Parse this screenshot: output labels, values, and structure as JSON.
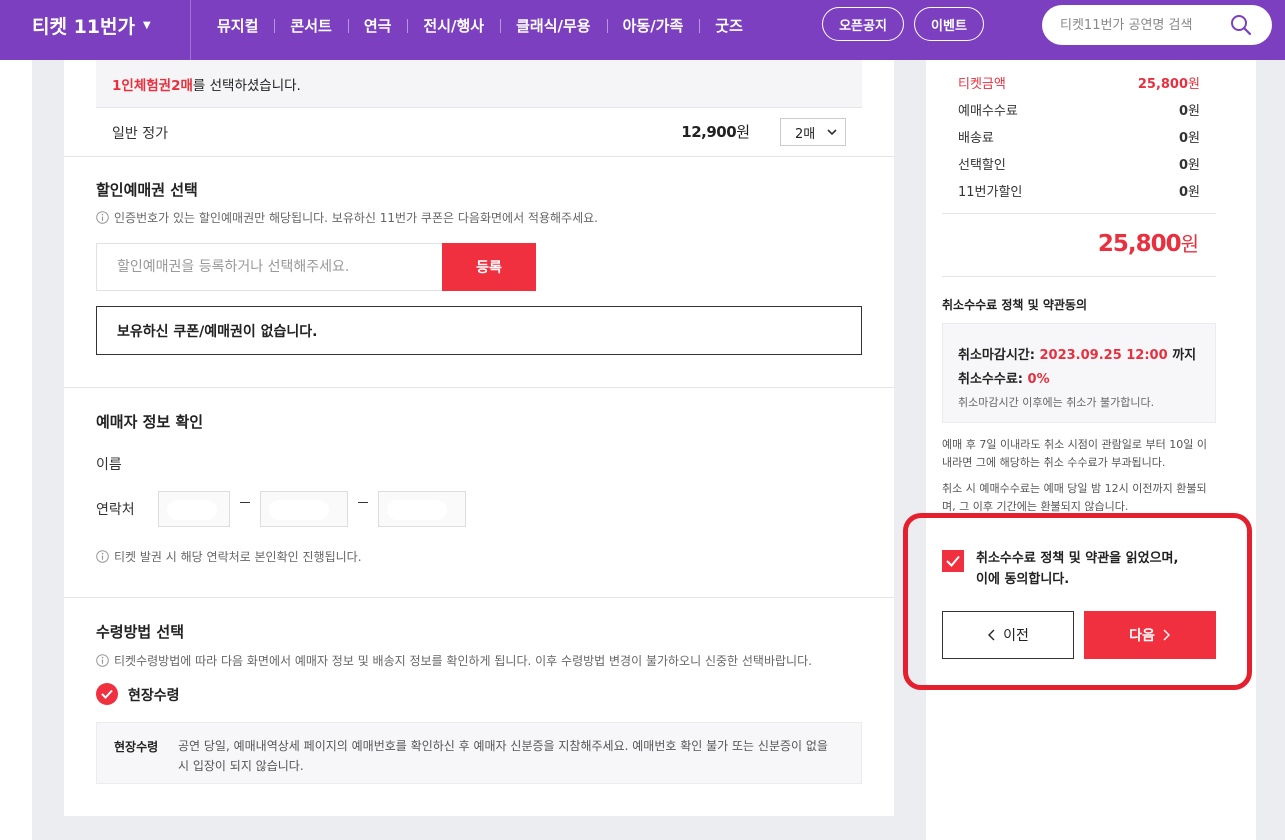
{
  "header": {
    "brand": "티켓 11번가",
    "nav": [
      "뮤지컬",
      "콘서트",
      "연극",
      "전시/행사",
      "클래식/무용",
      "아동/가족",
      "굿즈"
    ],
    "pill_open": "오픈공지",
    "pill_event": "이벤트",
    "search_placeholder": "티켓11번가 공연명 검색"
  },
  "selection": {
    "ticket_name": "1인체험권",
    "count": "2매",
    "suffix": "를 선택하셨습니다.",
    "price_label": "일반 정가",
    "price": "12,900",
    "won": "원",
    "qty": "2매"
  },
  "discount": {
    "title": "할인예매권 선택",
    "note": "인증번호가 있는 할인예매권만 해당됩니다. 보유하신 11번가 쿠폰은 다음화면에서 적용해주세요.",
    "input_placeholder": "할인예매권을 등록하거나 선택해주세요.",
    "register": "등록",
    "empty": "보유하신 쿠폰/예매권이 없습니다."
  },
  "booker": {
    "title": "예매자 정보 확인",
    "name_label": "이름",
    "phone_label": "연락처",
    "note": "티켓 발권 시 해당 연락처로 본인확인 진행됩니다."
  },
  "receive": {
    "title": "수령방법 선택",
    "note": "티켓수령방법에 따라 다음 화면에서 예매자 정보 및 배송지 정보를 확인하게 됩니다. 이후 수령방법 변경이 불가하오니 신중한 선택바랍니다.",
    "option": "현장수령",
    "box_title": "현장수령",
    "box_text": "공연 당일, 예매내역상세 페이지의 예매번호를 확인하신 후 예매자 신분증을 지참해주세요. 예매번호 확인 불가 또는 신분증이 없을 시 입장이 되지 않습니다."
  },
  "fees": [
    {
      "label": "티켓금액",
      "value": "25,800",
      "unit": "원"
    },
    {
      "label": "예매수수료",
      "value": "0",
      "unit": "원"
    },
    {
      "label": "배송료",
      "value": "0",
      "unit": "원"
    },
    {
      "label": "선택할인",
      "value": "0",
      "unit": "원"
    },
    {
      "label": "11번가할인",
      "value": "0",
      "unit": "원"
    }
  ],
  "total": {
    "value": "25,800",
    "unit": "원"
  },
  "policy": {
    "title": "취소수수료 정책 및 약관동의",
    "deadline_label": "취소마감시간:",
    "deadline_value": "2023.09.25 12:00",
    "deadline_suffix": "까지",
    "fee_label": "취소수수료:",
    "fee_value": "0%",
    "box_note": "취소마감시간 이후에는 취소가 불가합니다.",
    "text1": "예매 후 7일 이내라도 취소 시점이 관람일로 부터 10일 이내라면 그에 해당하는 취소 수수료가 부과됩니다.",
    "text2": "취소 시 예매수수료는 예매 당일 밤 12시 이전까지 환불되며, 그 이후 기간에는 환불되지 않습니다.",
    "agree_line1": "취소수수료 정책 및 약관을 읽었으며,",
    "agree_line2": "이에 동의합니다."
  },
  "buttons": {
    "prev": "이전",
    "next": "다음"
  },
  "colors": {
    "brand": "#7b3fbf",
    "accent": "#f0303f",
    "highlight": "#e5202e"
  }
}
